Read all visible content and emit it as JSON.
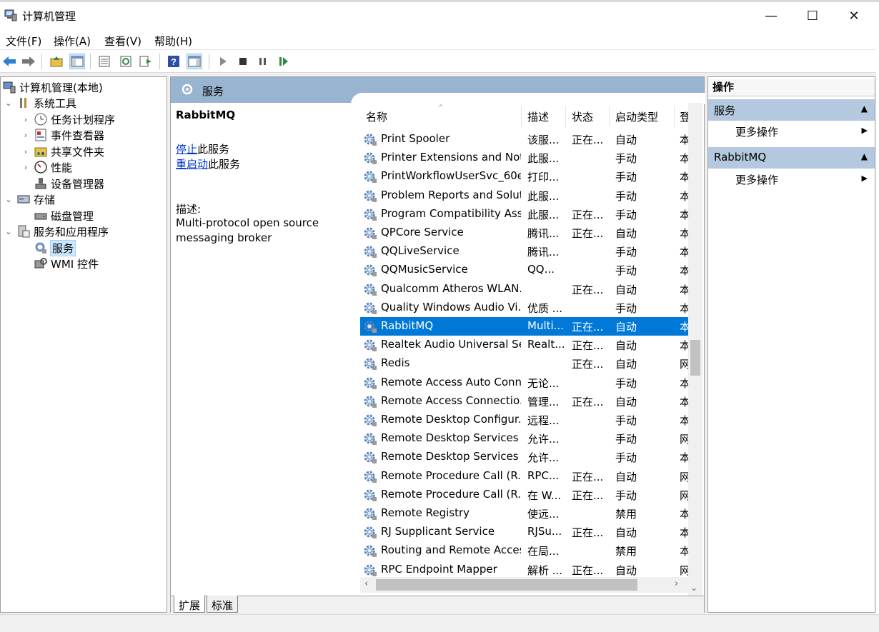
{
  "window": {
    "title": "计算机管理",
    "controls": {
      "minimize": "—",
      "maximize": "☐",
      "close": "✕"
    }
  },
  "menu": [
    "文件(F)",
    "操作(A)",
    "查看(V)",
    "帮助(H)"
  ],
  "tree": {
    "root": "计算机管理(本地)",
    "system_tools": "系统工具",
    "task_scheduler": "任务计划程序",
    "event_viewer": "事件查看器",
    "shared_folders": "共享文件夹",
    "performance": "性能",
    "device_manager": "设备管理器",
    "storage": "存储",
    "disk_management": "磁盘管理",
    "services_apps": "服务和应用程序",
    "services": "服务",
    "wmi": "WMI 控件"
  },
  "center": {
    "header_title": "服务",
    "selected_service": "RabbitMQ",
    "stop_link": "停止",
    "stop_suffix": "此服务",
    "restart_link": "重启动",
    "restart_suffix": "此服务",
    "desc_label": "描述:",
    "desc_line1": "Multi-protocol open source",
    "desc_line2": "messaging broker",
    "columns": {
      "name": "名称",
      "desc": "描述",
      "status": "状态",
      "startup": "启动类型",
      "login": "登"
    },
    "tabs": {
      "extended": "扩展",
      "standard": "标准"
    }
  },
  "services": [
    {
      "name": "Print Spooler",
      "desc": "该服...",
      "status": "正在...",
      "startup": "自动",
      "login": "本"
    },
    {
      "name": "Printer Extensions and Noti...",
      "desc": "此服...",
      "status": "",
      "startup": "手动",
      "login": "本"
    },
    {
      "name": "PrintWorkflowUserSvc_60e...",
      "desc": "打印...",
      "status": "",
      "startup": "手动",
      "login": "本"
    },
    {
      "name": "Problem Reports and Solut...",
      "desc": "此服...",
      "status": "",
      "startup": "手动",
      "login": "本"
    },
    {
      "name": "Program Compatibility Assi...",
      "desc": "此服...",
      "status": "正在...",
      "startup": "手动",
      "login": "本"
    },
    {
      "name": "QPCore Service",
      "desc": "腾讯...",
      "status": "正在...",
      "startup": "自动",
      "login": "本"
    },
    {
      "name": "QQLiveService",
      "desc": "腾讯...",
      "status": "",
      "startup": "手动",
      "login": "本"
    },
    {
      "name": "QQMusicService",
      "desc": "QQ...",
      "status": "",
      "startup": "手动",
      "login": "本"
    },
    {
      "name": "Qualcomm Atheros WLAN...",
      "desc": "",
      "status": "正在...",
      "startup": "自动",
      "login": "本"
    },
    {
      "name": "Quality Windows Audio Vi...",
      "desc": "优质 ...",
      "status": "",
      "startup": "手动",
      "login": "本"
    },
    {
      "name": "RabbitMQ",
      "desc": "Multi...",
      "status": "正在...",
      "startup": "自动",
      "login": "本"
    },
    {
      "name": "Realtek Audio Universal Se...",
      "desc": "Realt...",
      "status": "正在...",
      "startup": "自动",
      "login": "本"
    },
    {
      "name": "Redis",
      "desc": "",
      "status": "正在...",
      "startup": "自动",
      "login": "网"
    },
    {
      "name": "Remote Access Auto Conn...",
      "desc": "无论...",
      "status": "",
      "startup": "手动",
      "login": "本"
    },
    {
      "name": "Remote Access Connectio...",
      "desc": "管理...",
      "status": "正在...",
      "startup": "自动",
      "login": "本"
    },
    {
      "name": "Remote Desktop Configur...",
      "desc": "远程...",
      "status": "",
      "startup": "手动",
      "login": "本"
    },
    {
      "name": "Remote Desktop Services",
      "desc": "允许...",
      "status": "",
      "startup": "手动",
      "login": "网"
    },
    {
      "name": "Remote Desktop Services ...",
      "desc": "允许...",
      "status": "",
      "startup": "手动",
      "login": "本"
    },
    {
      "name": "Remote Procedure Call (R...",
      "desc": "RPC...",
      "status": "正在...",
      "startup": "自动",
      "login": "网"
    },
    {
      "name": "Remote Procedure Call (R...",
      "desc": "在 W...",
      "status": "正在...",
      "startup": "手动",
      "login": "网"
    },
    {
      "name": "Remote Registry",
      "desc": "使远...",
      "status": "",
      "startup": "禁用",
      "login": "本"
    },
    {
      "name": "RJ Supplicant Service",
      "desc": "RJSu...",
      "status": "正在...",
      "startup": "自动",
      "login": "本"
    },
    {
      "name": "Routing and Remote Access",
      "desc": "在局...",
      "status": "",
      "startup": "禁用",
      "login": "本"
    },
    {
      "name": "RPC Endpoint Mapper",
      "desc": "解析 ...",
      "status": "正在...",
      "startup": "自动",
      "login": "网"
    }
  ],
  "actions": {
    "title": "操作",
    "section1": "服务",
    "section1_item": "更多操作",
    "section2": "RabbitMQ",
    "section2_item": "更多操作"
  },
  "colors": {
    "selection": "#0078d7",
    "header": "#98b4d0",
    "action_section": "#b4c8e0",
    "link": "#0033cc"
  }
}
